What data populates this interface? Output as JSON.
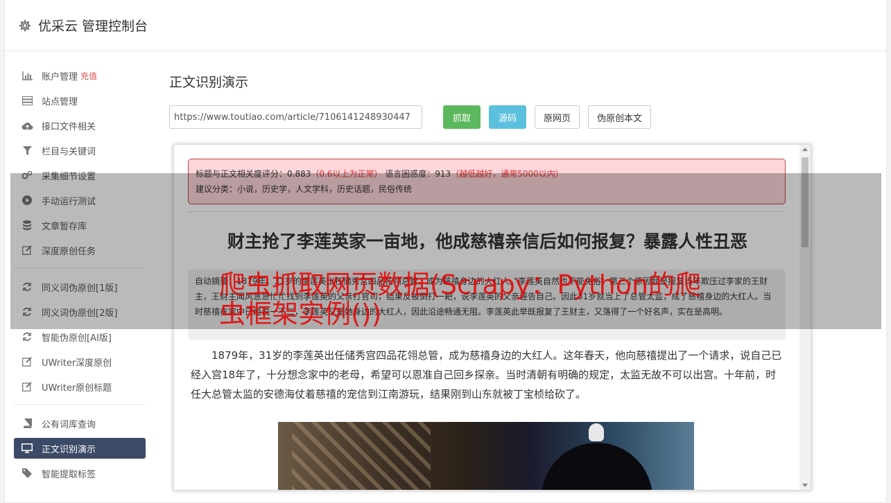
{
  "header": {
    "title": "优采云 管理控制台",
    "icon": "gear-icon"
  },
  "sidebar": {
    "group1": [
      {
        "label": "账户管理",
        "extra": "充值",
        "icon": "bar-chart-icon"
      },
      {
        "label": "站点管理",
        "icon": "server-icon"
      },
      {
        "label": "接口文件相关",
        "icon": "cloud-upload-icon"
      },
      {
        "label": "栏目与关键词",
        "icon": "filter-icon"
      },
      {
        "label": "采集细节设置",
        "icon": "gears-icon"
      },
      {
        "label": "手动运行测试",
        "icon": "play-circle-icon"
      },
      {
        "label": "文章暂存库",
        "icon": "database-icon"
      },
      {
        "label": "深度原创任务",
        "icon": "edit-icon"
      }
    ],
    "group2": [
      {
        "label": "同义词伪原创[1版]",
        "icon": "refresh-icon"
      },
      {
        "label": "同义词伪原创[2版]",
        "icon": "refresh-icon"
      },
      {
        "label": "智能伪原创[AI版]",
        "icon": "refresh-icon"
      },
      {
        "label": "UWriter深度原创",
        "icon": "edit-icon"
      },
      {
        "label": "UWriter原创标题",
        "icon": "edit-icon"
      }
    ],
    "group3": [
      {
        "label": "公有词库查询",
        "icon": "book-icon"
      },
      {
        "label": "正文识别演示",
        "icon": "monitor-icon",
        "active": true
      },
      {
        "label": "智能提取标签",
        "icon": "tag-icon"
      }
    ]
  },
  "main": {
    "page_title": "正文识别演示",
    "url_value": "https://www.toutiao.com/article/7106141248930447",
    "buttons": {
      "fetch": "抓取",
      "source": "源码",
      "original": "原网页",
      "pseudo": "伪原创本文"
    }
  },
  "result": {
    "relevance_label": "标题与正文相关度评分：0.883",
    "relevance_note": "（0.6以上为正常）",
    "perplexity_label": "语言困惑度：913",
    "perplexity_note": "（越低越好，通常5000以内）",
    "category_line": "建议分类：小说，历史学，人文学科，历史话题，民俗传统",
    "article_title": "财主抢了李莲英家一亩地，他成慈禧亲信后如何报复？暴露人性丑恶",
    "summary": "自动摘要：1879年，31岁的李莲英出任储秀宫四品花翎总管，成为慈禧身边的大红人。”李莲英自然也不能免俗；第三个原因就是报复当年欺压过李家的王财主，王财主闻风急急忙忙找到李莲英的父亲打官司，结果反被倒打一耙，说李莲英的父亲诬告自己。因此31岁就当上了总管太监，成了慈禧身边的大红人。当时慈禧在宫中已经说一不二，李莲英又是她身边的大红人，因此沿途畅通无阻。李莲英此举既报复了王财主，又落得了一个好名声，实在是高明。",
    "paragraph": "1879年，31岁的李莲英出任储秀宫四品花翎总管，成为慈禧身边的大红人。这年春天，他向慈禧提出了一个请求，说自己已经入宫18年了，十分想念家中的老母，希望可以恩准自己回乡探亲。当时清朝有明确的规定，太监无故不可以出宫。十年前，时任大总管太监的安德海仗着慈禧的宠信到江南游玩，结果刚到山东就被丁宝桢给砍了。"
  },
  "watermark": "爬虫抓取网页数据(Scrapy：Python的爬虫框架实例())"
}
